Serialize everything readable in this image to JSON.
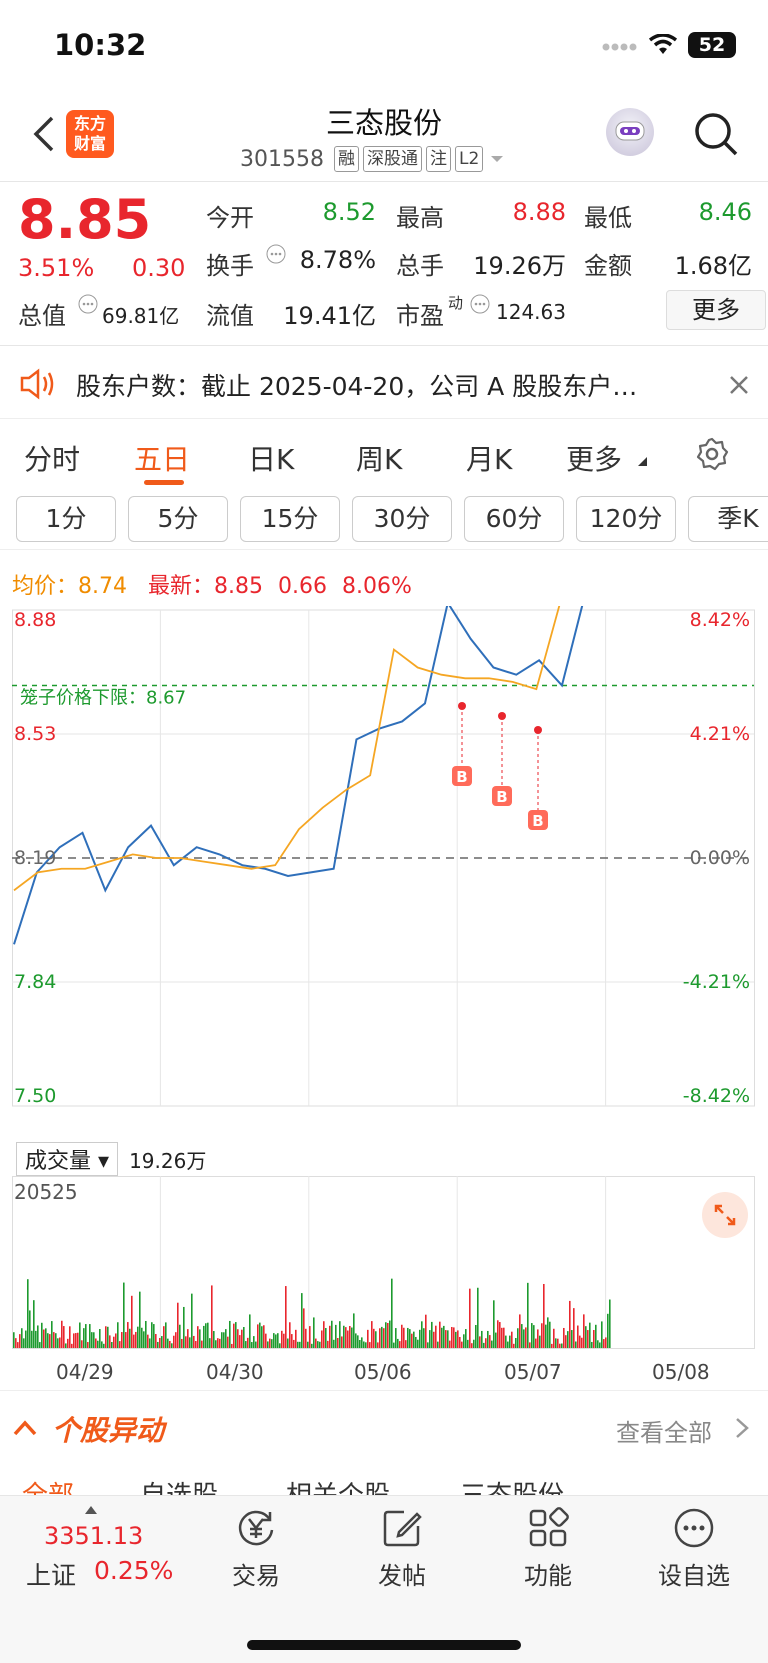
{
  "status": {
    "time": "10:32",
    "battery": "52"
  },
  "header": {
    "logo_line1": "东方",
    "logo_line2": "财富",
    "title": "三态股份",
    "code": "301558",
    "tags": [
      "融",
      "深股通",
      "注",
      "L2"
    ]
  },
  "quote": {
    "price": "8.85",
    "change_pct": "3.51%",
    "change": "0.30",
    "open_label": "今开",
    "open": "8.52",
    "high_label": "最高",
    "high": "8.88",
    "low_label": "最低",
    "low": "8.46",
    "turnover_label": "换手",
    "turnover": "8.78%",
    "volume_label": "总手",
    "volume": "19.26万",
    "amount_label": "金额",
    "amount": "1.68亿",
    "mktcap_label": "总值",
    "mktcap": "69.81亿",
    "float_label": "流值",
    "float": "19.41亿",
    "pe_label": "市盈",
    "pe_sup": "动",
    "pe": "124.63",
    "more": "更多"
  },
  "notice": {
    "text": "股东户数：截止 2025-04-20，公司 A 股股东户…"
  },
  "tabs": [
    "分时",
    "五日",
    "日K",
    "周K",
    "月K",
    "更多"
  ],
  "periods": [
    "1分",
    "5分",
    "15分",
    "30分",
    "60分",
    "120分",
    "季K"
  ],
  "legend": {
    "avg_label": "均价：",
    "avg": "8.74",
    "last_label": "最新：",
    "last": "8.85",
    "chg": "0.66",
    "chg_pct": "8.06%"
  },
  "chart_data": {
    "type": "line",
    "y_left": [
      "8.88",
      "8.53",
      "8.19",
      "7.84",
      "7.50"
    ],
    "y_right": [
      "8.42%",
      "4.21%",
      "0.00%",
      "-4.21%",
      "-8.42%"
    ],
    "x": [
      "04/29",
      "04/30",
      "05/06",
      "05/07",
      "05/08"
    ],
    "band_label": "笼子价格下限：",
    "band_value": "8.67",
    "marker": "B",
    "series": [
      {
        "name": "price",
        "values": [
          7.95,
          8.15,
          8.22,
          8.26,
          8.1,
          8.22,
          8.28,
          8.17,
          8.22,
          8.2,
          8.17,
          8.16,
          8.14,
          8.15,
          8.16,
          8.52,
          8.55,
          8.57,
          8.62,
          8.9,
          8.8,
          8.72,
          8.7,
          8.74,
          8.67,
          8.92,
          9.05
        ]
      },
      {
        "name": "avg",
        "values": [
          8.1,
          8.15,
          8.16,
          8.16,
          8.18,
          8.2,
          8.19,
          8.19,
          8.18,
          8.17,
          8.16,
          8.17,
          8.27,
          8.33,
          8.38,
          8.42,
          8.77,
          8.72,
          8.7,
          8.69,
          8.69,
          8.68,
          8.66,
          8.9,
          8.92,
          8.92
        ]
      }
    ],
    "ylim": [
      7.5,
      8.88
    ]
  },
  "volume": {
    "selector": "成交量",
    "total": "19.26万",
    "max": "20525"
  },
  "section": {
    "title": "个股异动",
    "link": "查看全部",
    "tabs": [
      "全部",
      "自选股",
      "相关个股",
      "三态股份"
    ]
  },
  "bottomnav": {
    "index_value": "3351.13",
    "index_name": "上证",
    "index_pct": "0.25%",
    "items": [
      "交易",
      "发帖",
      "功能",
      "设自选"
    ]
  }
}
